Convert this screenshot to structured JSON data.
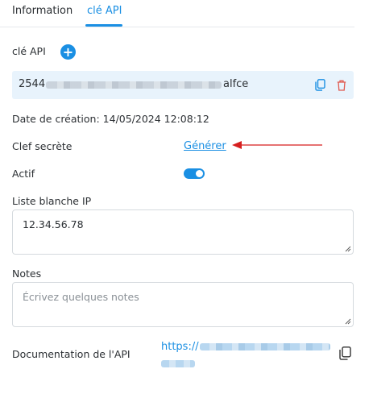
{
  "tabs": [
    {
      "label": "Information",
      "active": false
    },
    {
      "label": "clé API",
      "active": true
    }
  ],
  "api_key": {
    "section_label": "clé API",
    "add_symbol": "+",
    "value_visible_prefix": "2544",
    "value_visible_suffix": "alfce"
  },
  "created": {
    "label": "Date de création: 14/05/2024 12:08:12"
  },
  "secret": {
    "label": "Clef secrète",
    "action": "Générer"
  },
  "active": {
    "label": "Actif",
    "enabled": true
  },
  "ip_whitelist": {
    "label": "Liste blanche IP",
    "value": "12.34.56.78"
  },
  "notes": {
    "label": "Notes",
    "placeholder": "Écrivez quelques notes"
  },
  "documentation": {
    "label": "Documentation de l'API",
    "link_visible_prefix": "https://"
  },
  "colors": {
    "accent": "#1a8fe3",
    "danger": "#e05a4f",
    "annotation_arrow": "#d61f1f",
    "key_background": "#e8f3fc"
  }
}
